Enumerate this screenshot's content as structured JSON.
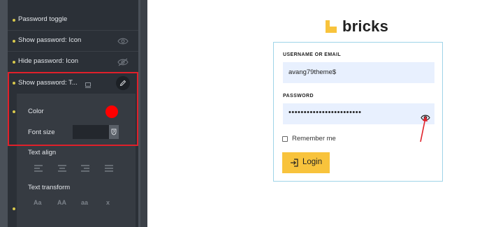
{
  "editor": {
    "rows": [
      {
        "label": "Password toggle",
        "control": "toggle",
        "toggle_on": true
      },
      {
        "label": "Show password: Icon",
        "control": "eye-icon"
      },
      {
        "label": "Hide password: Icon",
        "control": "eye-off-icon"
      },
      {
        "label": "Show password: T...",
        "control": "edit-button",
        "active": true
      }
    ],
    "typography": {
      "color_label": "Color",
      "color_value": "#ff0000",
      "font_size_label": "Font size",
      "font_size_value": "",
      "text_align_label": "Text align",
      "text_align_options": [
        "left-align-icon",
        "center-align-icon",
        "right-align-icon",
        "justify-align-icon"
      ],
      "text_transform_label": "Text transform",
      "text_transform_options": [
        "Aa",
        "AA",
        "aa",
        "x"
      ]
    }
  },
  "preview": {
    "logo_text": "bricks",
    "username_label": "USERNAME OR EMAIL",
    "username_value": "avang79theme$",
    "password_label": "PASSWORD",
    "password_value": "••••••••••••••••••••••••",
    "remember_label": "Remember me",
    "login_label": "Login"
  },
  "colors": {
    "accent": "#f8c33c",
    "highlight_border": "#e0202a",
    "panel_bg": "#2b3037",
    "field_bg": "#e8f0fe",
    "box_border": "#9fd4e8"
  }
}
